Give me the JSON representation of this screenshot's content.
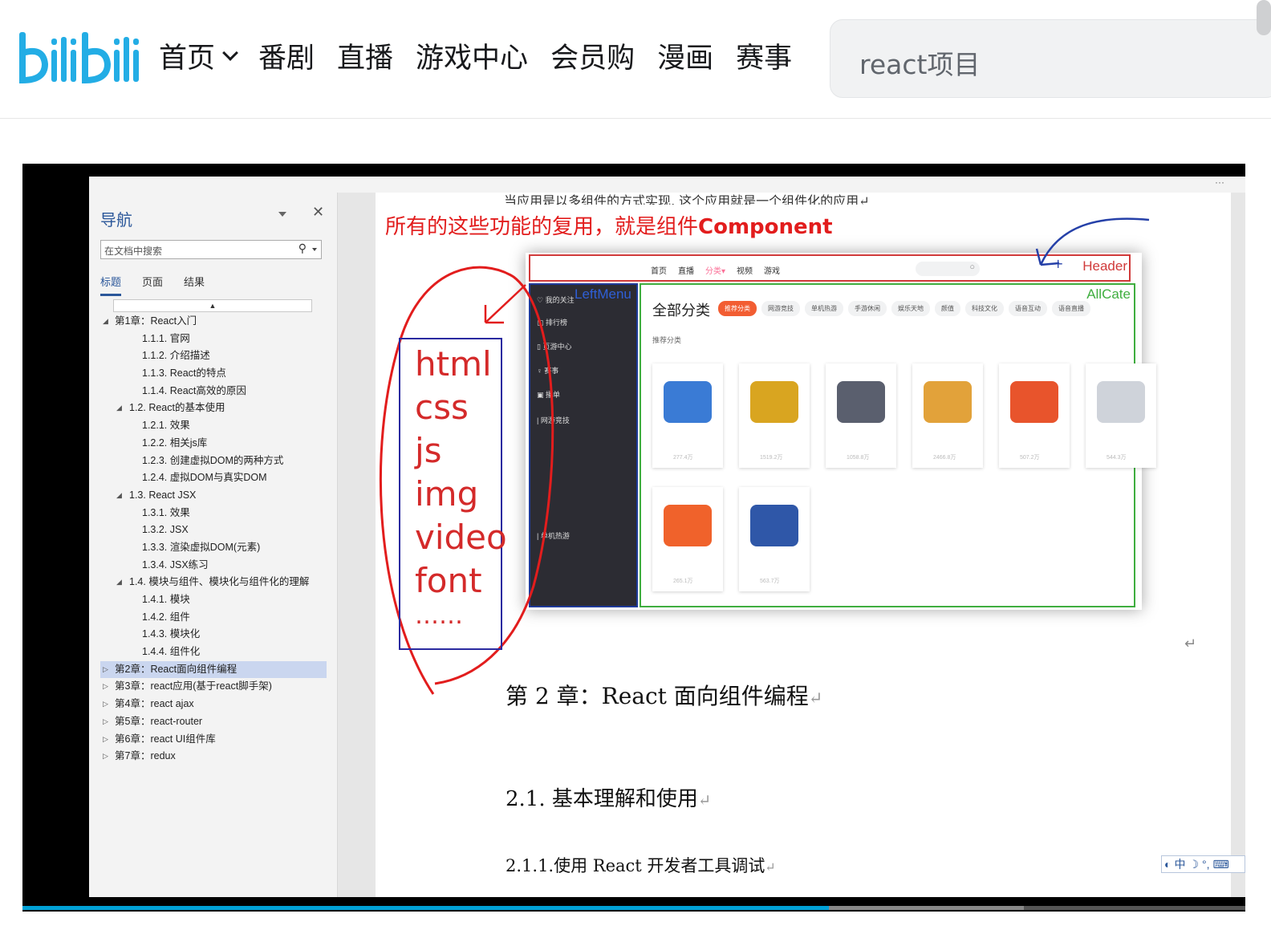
{
  "topbar": {
    "logo_text": "bilibili",
    "nav": [
      "首页",
      "番剧",
      "直播",
      "游戏中心",
      "会员购",
      "漫画",
      "赛事"
    ],
    "search_value": "react项目"
  },
  "doc": {
    "nav_pane": {
      "title": "导航",
      "search_placeholder": "在文档中搜索",
      "tabs": [
        "标题",
        "页面",
        "结果"
      ],
      "tree": [
        {
          "label": "第1章：React入门",
          "level": 0,
          "state": "expanded"
        },
        {
          "label": "1.1.1. 官网",
          "level": 2
        },
        {
          "label": "1.1.2. 介绍描述",
          "level": 2
        },
        {
          "label": "1.1.3. React的特点",
          "level": 2
        },
        {
          "label": "1.1.4. React高效的原因",
          "level": 2
        },
        {
          "label": "1.2. React的基本使用",
          "level": 1,
          "state": "expanded"
        },
        {
          "label": "1.2.1. 效果",
          "level": 2
        },
        {
          "label": "1.2.2. 相关js库",
          "level": 2
        },
        {
          "label": "1.2.3. 创建虚拟DOM的两种方式",
          "level": 2
        },
        {
          "label": "1.2.4. 虚拟DOM与真实DOM",
          "level": 2
        },
        {
          "label": "1.3. React JSX",
          "level": 1,
          "state": "expanded"
        },
        {
          "label": "1.3.1. 效果",
          "level": 2
        },
        {
          "label": "1.3.2. JSX",
          "level": 2
        },
        {
          "label": "1.3.3. 渲染虚拟DOM(元素)",
          "level": 2
        },
        {
          "label": "1.3.4. JSX练习",
          "level": 2
        },
        {
          "label": "1.4. 模块与组件、模块化与组件化的理解",
          "level": 1,
          "state": "expanded"
        },
        {
          "label": "1.4.1. 模块",
          "level": 2
        },
        {
          "label": "1.4.2. 组件",
          "level": 2
        },
        {
          "label": "1.4.3. 模块化",
          "level": 2
        },
        {
          "label": "1.4.4. 组件化",
          "level": 2
        },
        {
          "label": "第2章：React面向组件编程",
          "level": 0,
          "state": "collapsed",
          "selected": true
        },
        {
          "label": "第3章：react应用(基于react脚手架)",
          "level": 0,
          "state": "collapsed"
        },
        {
          "label": "第4章：react ajax",
          "level": 0,
          "state": "collapsed"
        },
        {
          "label": "第5章：react-router",
          "level": 0,
          "state": "collapsed"
        },
        {
          "label": "第6章：react UI组件库",
          "level": 0,
          "state": "collapsed"
        },
        {
          "label": "第7章：redux",
          "level": 0,
          "state": "collapsed"
        }
      ]
    },
    "page": {
      "cut_line": "当应用是以多组件的方式实现, 这个应用就是一个组件化的应用↵",
      "red_caption_prefix": "所有的这些功能的复用，就是组件",
      "red_caption_bold": "Component",
      "annotation_list": [
        "html",
        "css",
        "js",
        "img",
        "video",
        "font",
        "……"
      ],
      "headings": {
        "ch2": "第 2 章：React 面向组件编程",
        "s21": "2.1. 基本理解和使用",
        "s211": "2.1.1.使用 React 开发者工具调试"
      },
      "return_mark": "↵"
    },
    "screenshot": {
      "header_label": "Header",
      "leftmenu_label": "LeftMenu",
      "allcate_label": "AllCate",
      "nav": [
        "首页",
        "直播",
        "分类",
        "视频",
        "游戏"
      ],
      "active_nav": "分类",
      "left_items": [
        "我的关注",
        "排行榜",
        "页游中心",
        "赛事",
        "播单",
        "网游竞技",
        "单机热游"
      ],
      "title": "全部分类",
      "chips": [
        "推荐分类",
        "网游竞技",
        "单机热游",
        "手游休闲",
        "娱乐天地",
        "颜值",
        "科技文化",
        "语音互动",
        "语音直播"
      ],
      "subtitle": "推荐分类",
      "cards": [
        {
          "num": "277.4万",
          "color": "#3a7bd5"
        },
        {
          "num": "1519.2万",
          "color": "#d9a520"
        },
        {
          "num": "1058.8万",
          "color": "#5a5f6e"
        },
        {
          "num": "2466.8万",
          "color": "#e2a23a"
        },
        {
          "num": "507.2万",
          "color": "#e8542c"
        },
        {
          "num": "544.3万",
          "color": "#cfd3da"
        },
        {
          "num": "265.1万",
          "color": "#f0622b"
        },
        {
          "num": "563.7万",
          "color": "#2f57a8"
        }
      ]
    },
    "ime": "中"
  }
}
